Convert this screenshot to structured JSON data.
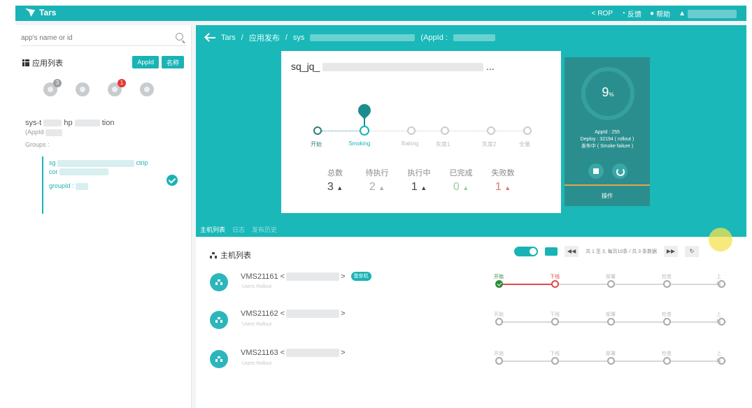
{
  "header": {
    "app_name": "Tars",
    "nav": [
      "ROP",
      "反馈",
      "帮助"
    ]
  },
  "sidebar": {
    "search_placeholder": "app's name or id",
    "list_title": "应用列表",
    "buttons": [
      "AppId",
      "名称"
    ],
    "badges": [
      "3",
      "1"
    ],
    "app_name_prefix": "sys-t",
    "app_name_mid": "hp",
    "app_name_suffix": "tion",
    "app_id_label": "(AppId",
    "groups_label": "Groups :",
    "group_line1": "sg",
    "group_line1_suffix": "ctrip",
    "group_line2": "cor",
    "group_id_label": "groupId :"
  },
  "breadcrumb": {
    "root": "Tars",
    "section": "应用发布",
    "app": "sys",
    "appid_label": "(AppId :"
  },
  "deploy": {
    "title_prefix": "sq_jq_",
    "steps": [
      {
        "label": "开始",
        "state": "done"
      },
      {
        "label": "Smoking",
        "state": "active"
      },
      {
        "label": "Baking",
        "state": "pending"
      },
      {
        "label": "灰度1",
        "state": "pending"
      },
      {
        "label": "灰度2",
        "state": "pending"
      },
      {
        "label": "全量",
        "state": "pending"
      }
    ],
    "stats": [
      {
        "label": "总数",
        "value": "3",
        "kind": "total"
      },
      {
        "label": "待执行",
        "value": "2",
        "kind": "pending"
      },
      {
        "label": "执行中",
        "value": "1",
        "kind": "running"
      },
      {
        "label": "已完成",
        "value": "0",
        "kind": "done"
      },
      {
        "label": "失败数",
        "value": "1",
        "kind": "fail"
      }
    ],
    "progress_value": "9",
    "progress_unit": "%",
    "panel_lines": [
      "AppId : 255",
      "Deploy : 32194 ( rollout )",
      "发布中 ( Smoke failure )"
    ],
    "panel_action": "操作"
  },
  "tabs": [
    "主机列表",
    "日志",
    "发布历史"
  ],
  "hosts": {
    "title": "主机列表",
    "pager_text": "共 1 至 3, 每页10条 / 共 3 条数据",
    "rows": [
      {
        "name": "VMS21161 <",
        "tag": "堡垒机",
        "meta": "Users   Rollout"
      },
      {
        "name": "VMS21162 <",
        "tag": "",
        "meta": "Users   Rollout"
      },
      {
        "name": "VMS21163 <",
        "tag": "",
        "meta": "Users   Rollout"
      }
    ],
    "row_steps": [
      [
        {
          "label": "开始",
          "state": "ok"
        },
        {
          "label": "下线",
          "state": "err"
        },
        {
          "label": "部署",
          "state": "pending"
        },
        {
          "label": "检查",
          "state": "pending"
        },
        {
          "label": "上线",
          "state": "pending"
        }
      ],
      [
        {
          "label": "开始",
          "state": "pending"
        },
        {
          "label": "下线",
          "state": "pending"
        },
        {
          "label": "部署",
          "state": "pending"
        },
        {
          "label": "检查",
          "state": "pending"
        },
        {
          "label": "上线",
          "state": "pending"
        }
      ],
      [
        {
          "label": "开始",
          "state": "pending"
        },
        {
          "label": "下线",
          "state": "pending"
        },
        {
          "label": "部署",
          "state": "pending"
        },
        {
          "label": "检查",
          "state": "pending"
        },
        {
          "label": "上线",
          "state": "pending"
        }
      ]
    ]
  },
  "colors": {
    "accent": "#19b3b5",
    "panel": "#2b8e8e",
    "error": "#e04a4a",
    "ok": "#2e8b3a"
  }
}
